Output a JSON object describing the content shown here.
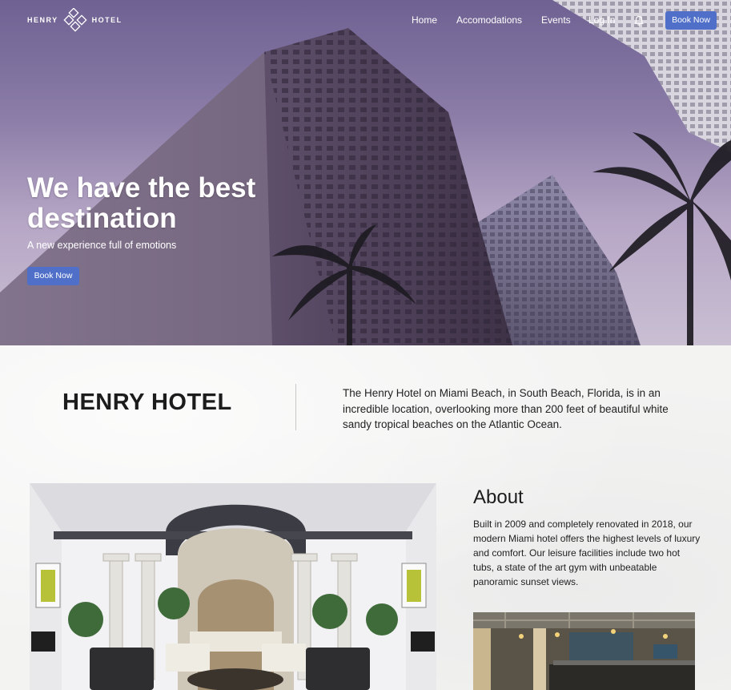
{
  "nav": {
    "logo_left": "HENRY",
    "logo_right": "HOTEL",
    "links": [
      "Home",
      "Accomodations",
      "Events",
      "Log In"
    ],
    "book_label": "Book Now"
  },
  "hero": {
    "title": "We have the best destination",
    "subtitle": "A new experience full of emotions",
    "book_label": "Book Now"
  },
  "intro": {
    "heading": "HENRY HOTEL",
    "text": "The Henry Hotel on Miami Beach, in South Beach, Florida, is in an incredible location, overlooking more than 200 feet of beautiful white sandy tropical beaches on the Atlantic Ocean."
  },
  "about": {
    "title": "About",
    "text": "Built in 2009 and completely renovated in 2018, our modern Miami hotel offers the highest levels of luxury and comfort. Our leisure facilities include two hot tubs, a state of the art gym with unbeatable panoramic sunset views."
  },
  "colors": {
    "accent": "#4f6fc8",
    "hero_sky": "#8c7ea8",
    "text_dark": "#1c1c1c"
  },
  "icons": [
    "diamond-logo-icon",
    "bell-icon"
  ]
}
